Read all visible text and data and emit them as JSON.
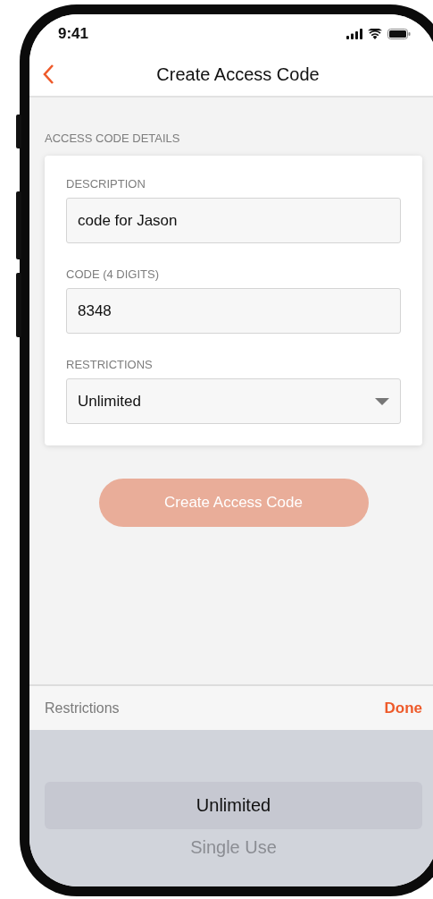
{
  "status_bar": {
    "time": "9:41"
  },
  "nav": {
    "title": "Create Access Code"
  },
  "section": {
    "title": "ACCESS CODE DETAILS"
  },
  "fields": [
    {
      "label": "DESCRIPTION",
      "value": "code for Jason",
      "kind": "text"
    },
    {
      "label": "CODE (4 DIGITS)",
      "value": "8348",
      "kind": "text"
    },
    {
      "label": "RESTRICTIONS",
      "value": "Unlimited",
      "kind": "select"
    }
  ],
  "submit_button": {
    "label": "Create Access Code",
    "disabled": true
  },
  "picker": {
    "title": "Restrictions",
    "done": "Done",
    "options": [
      {
        "label": "Unlimited",
        "selected": true
      },
      {
        "label": "Single Use",
        "selected": false
      }
    ]
  }
}
